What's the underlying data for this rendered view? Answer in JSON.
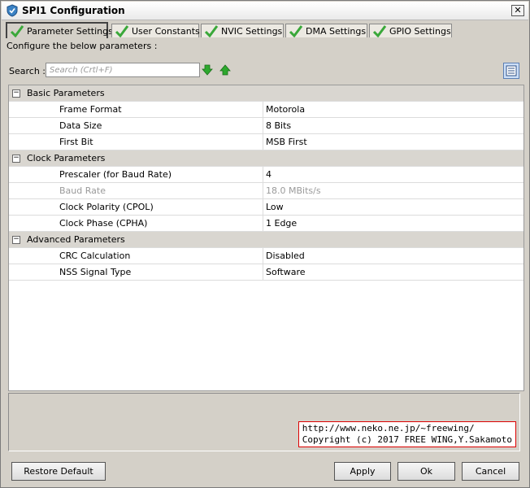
{
  "window": {
    "title": "SPI1 Configuration"
  },
  "tabs": [
    {
      "label": "Parameter Settings"
    },
    {
      "label": "User Constants"
    },
    {
      "label": "NVIC Settings"
    },
    {
      "label": "DMA Settings"
    },
    {
      "label": "GPIO Settings"
    }
  ],
  "intro_text": "Configure the below parameters :",
  "search": {
    "label": "Search :",
    "placeholder": "Search (Crtl+F)"
  },
  "groups": [
    {
      "name": "Basic Parameters",
      "params": [
        {
          "name": "Frame Format",
          "value": "Motorola"
        },
        {
          "name": "Data Size",
          "value": "8 Bits"
        },
        {
          "name": "First Bit",
          "value": "MSB First"
        }
      ]
    },
    {
      "name": "Clock Parameters",
      "params": [
        {
          "name": "Prescaler (for Baud Rate)",
          "value": "4"
        },
        {
          "name": "Baud Rate",
          "value": "18.0 MBits/s"
        },
        {
          "name": "Clock Polarity (CPOL)",
          "value": "Low"
        },
        {
          "name": "Clock Phase (CPHA)",
          "value": "1 Edge"
        }
      ]
    },
    {
      "name": "Advanced Parameters",
      "params": [
        {
          "name": "CRC Calculation",
          "value": "Disabled"
        },
        {
          "name": "NSS Signal Type",
          "value": "Software"
        }
      ]
    }
  ],
  "credit": {
    "line1": "http://www.neko.ne.jp/~freewing/",
    "line2": "Copyright (c) 2017 FREE WING,Y.Sakamoto"
  },
  "buttons": {
    "restore": "Restore Default",
    "apply": "Apply",
    "ok": "Ok",
    "cancel": "Cancel"
  },
  "colors": {
    "check": "#3aa83a",
    "arrow": "#2ea82e",
    "credit_border": "#dd0000"
  }
}
